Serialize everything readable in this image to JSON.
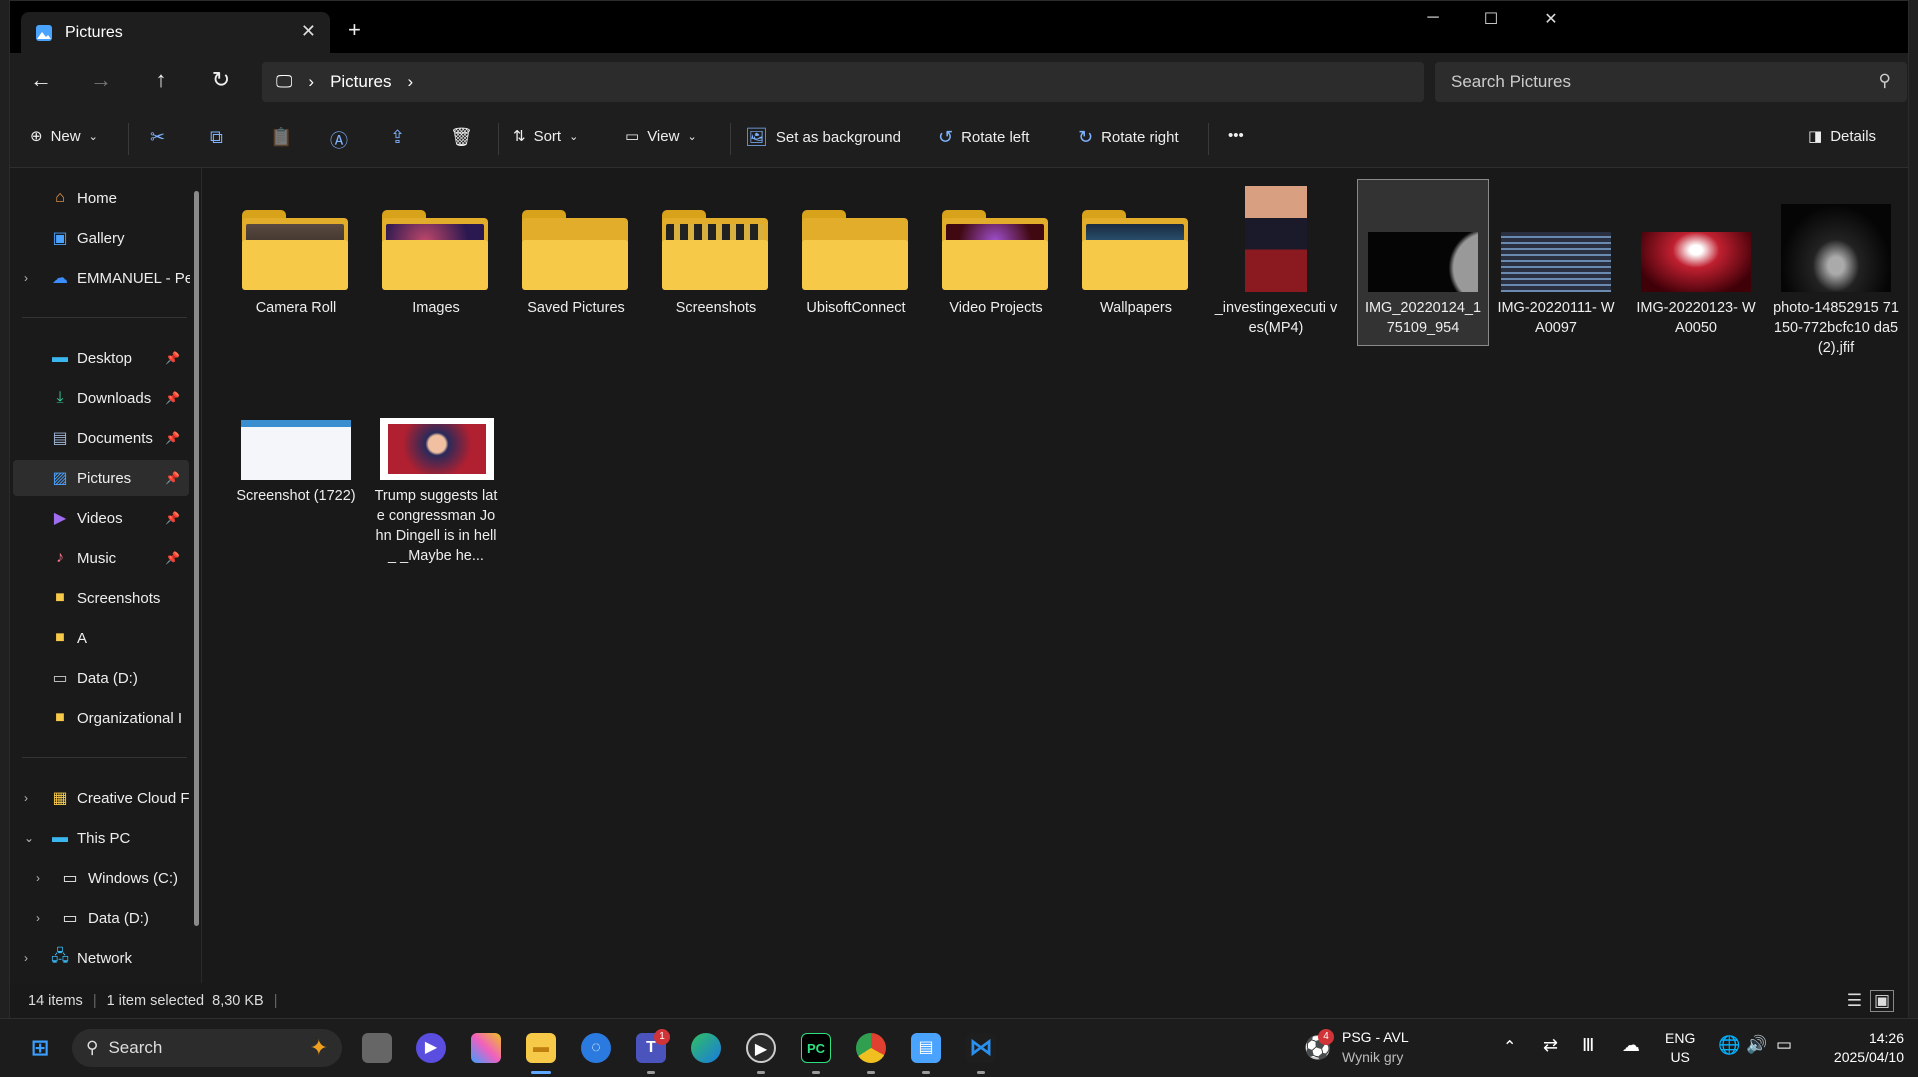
{
  "window": {
    "tab_title": "Pictures",
    "new_tab": "+",
    "controls": {
      "min": "─",
      "max": "☐",
      "close": "✕"
    }
  },
  "address": {
    "crumbs": [
      "Pictures"
    ],
    "search_placeholder": "Search Pictures"
  },
  "toolbar": {
    "new": "New",
    "sort": "Sort",
    "view": "View",
    "set_bg": "Set as background",
    "rotate_left": "Rotate left",
    "rotate_right": "Rotate right",
    "more": "•••",
    "details": "Details"
  },
  "sidebar": {
    "home": "Home",
    "gallery": "Gallery",
    "onedrive": "EMMANUEL - Pe",
    "desktop": "Desktop",
    "downloads": "Downloads",
    "documents": "Documents",
    "pictures": "Pictures",
    "videos": "Videos",
    "music": "Music",
    "screenshots": "Screenshots",
    "a": "A",
    "data": "Data (D:)",
    "org": "Organizational I",
    "creative": "Creative Cloud F",
    "thispc": "This PC",
    "windows": "Windows (C:)",
    "data2": "Data (D:)",
    "network": "Network"
  },
  "items": [
    {
      "name": "Camera Roll"
    },
    {
      "name": "Images"
    },
    {
      "name": "Saved Pictures"
    },
    {
      "name": "Screenshots"
    },
    {
      "name": "UbisoftConnect"
    },
    {
      "name": "Video Projects"
    },
    {
      "name": "Wallpapers"
    },
    {
      "name": "_investingexecuti ves(MP4)"
    },
    {
      "name": "IMG_20220124_1 75109_954"
    },
    {
      "name": "IMG-20220111- WA0097"
    },
    {
      "name": "IMG-20220123- WA0050"
    },
    {
      "name": "photo-14852915 71150-772bcfc10 da5 (2).jfif"
    },
    {
      "name": "Screenshot (1722)"
    },
    {
      "name": "Trump suggests late congressman John Dingell is in hell_ _Maybe he..."
    }
  ],
  "status": {
    "count": "14 items",
    "selected": "1 item selected",
    "size": "8,30 KB"
  },
  "taskbar": {
    "search": "Search",
    "news_title": "PSG - AVL",
    "news_sub": "Wynik gry",
    "news_badge": "4",
    "teams_badge": "1",
    "lang1": "ENG",
    "lang2": "US",
    "time": "14:26",
    "date": "2025/04/10"
  }
}
